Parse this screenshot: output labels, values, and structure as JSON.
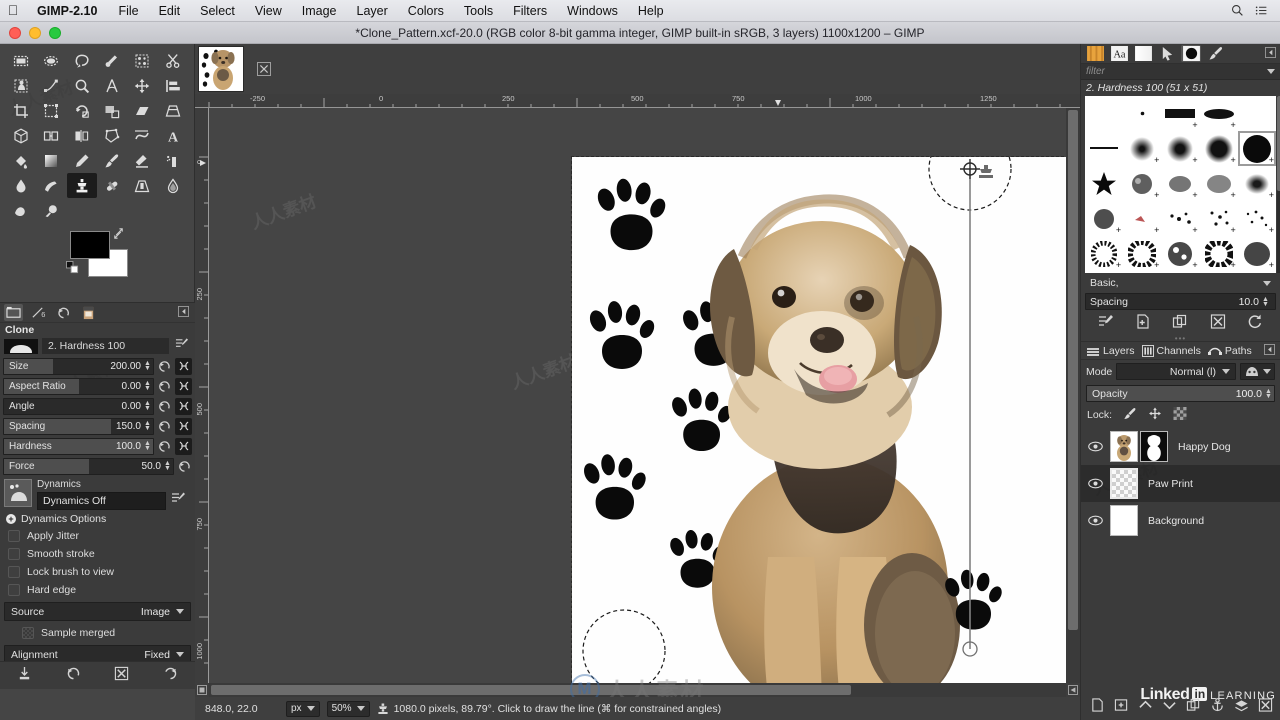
{
  "macmenu": {
    "app": "GIMP-2.10",
    "items": [
      "File",
      "Edit",
      "Select",
      "View",
      "Image",
      "Layer",
      "Colors",
      "Tools",
      "Filters",
      "Windows",
      "Help"
    ],
    "right_icons": [
      "search-icon",
      "list-icon"
    ]
  },
  "window": {
    "title": "*Clone_Pattern.xcf-20.0 (RGB color 8-bit gamma integer, GIMP built-in sRGB, 3 layers) 1100x1200 – GIMP"
  },
  "toolbox": {
    "tools": [
      "rect-select-tool",
      "ellipse-select-tool",
      "free-select-tool",
      "fuzzy-select-tool",
      "select-by-color-tool",
      "scissors-select-tool",
      "foreground-select-tool",
      "paths-tool",
      "color-picker-tool",
      "measure-tool",
      "move-tool",
      "alignment-tool",
      "crop-tool",
      "unified-transform-tool",
      "rotate-tool",
      "scale-tool",
      "shear-tool",
      "perspective-tool",
      "3d-transform-tool",
      "handle-transform-tool",
      "flip-tool",
      "cage-transform-tool",
      "warp-transform-tool",
      "text-tool",
      "bucket-fill-tool",
      "gradient-tool",
      "pencil-tool",
      "paintbrush-tool",
      "eraser-tool",
      "airbrush-tool",
      "ink-tool",
      "mypaint-brush-tool",
      "clone-tool",
      "heal-tool",
      "perspective-clone-tool",
      "blur-sharpen-tool",
      "smudge-tool",
      "dodge-burn-tool"
    ],
    "active_tool_index": 32,
    "foreground_color": "#000000",
    "background_color": "#ffffff"
  },
  "tool_options": {
    "panel_tabs": [
      "tool-options-tab",
      "device-status-tab",
      "undo-history-tab",
      "images-tab"
    ],
    "selected_panel_tab": 0,
    "tool_name": "Clone",
    "brush": "2. Hardness 100",
    "sliders": [
      {
        "label": "Size",
        "value": "200.00",
        "fill": 0.33,
        "link": true
      },
      {
        "label": "Aspect Ratio",
        "value": "0.00",
        "fill": 0.5,
        "link": true
      },
      {
        "label": "Angle",
        "value": "0.00",
        "fill": 0.0,
        "link": true
      },
      {
        "label": "Spacing",
        "value": "150.0",
        "fill": 0.72,
        "link": true
      },
      {
        "label": "Hardness",
        "value": "100.0",
        "fill": 1.0,
        "link": true
      },
      {
        "label": "Force",
        "value": "50.0",
        "fill": 0.5,
        "link": false
      }
    ],
    "dynamics_title": "Dynamics",
    "dynamics_value": "Dynamics Off",
    "dynamics_options_label": "Dynamics Options",
    "checkboxes": [
      {
        "label": "Apply Jitter",
        "checked": false
      },
      {
        "label": "Smooth stroke",
        "checked": false
      },
      {
        "label": "Lock brush to view",
        "checked": false
      },
      {
        "label": "Hard edge",
        "checked": false
      }
    ],
    "source_label": "Source",
    "source_value": "Image",
    "sample_merged_label": "Sample merged",
    "alignment_label": "Alignment",
    "alignment_value": "Fixed",
    "bottom_buttons": [
      "save-tool-preset-icon",
      "restore-tool-preset-icon",
      "delete-tool-preset-icon",
      "reset-tool-options-icon"
    ]
  },
  "image_window": {
    "tab_thumbnail_alt": "image-tab-thumbnail",
    "close_tab": "close-tab-icon",
    "ruler_h_ticks": [
      "-250",
      "0",
      "250",
      "500",
      "750",
      "1000",
      "1250"
    ],
    "ruler_v_ticks": [
      "0",
      "250",
      "500",
      "750",
      "1000"
    ]
  },
  "statusbar": {
    "pointer_position": "848.0, 22.0",
    "unit": "px",
    "zoom": "50%",
    "message": "1080.0 pixels, 89.79°. Click to draw the line (⌘ for constrained angles)"
  },
  "brushes_dock": {
    "tabs": [
      "patterns-tab",
      "fonts-tab",
      "gradients-tab",
      "pointer-tab",
      "brushes-tab",
      "paint-dynamics-tab"
    ],
    "selected_tab": 4,
    "filter_placeholder": "filter",
    "selected_brush_info": "2. Hardness 100 (51 x 51)",
    "tag_label": "Basic,",
    "spacing_label": "Spacing",
    "spacing_value": "10.0",
    "buttons": [
      "edit-brush-icon",
      "new-brush-icon",
      "duplicate-brush-icon",
      "delete-brush-icon",
      "refresh-brushes-icon"
    ],
    "selected_brush_index": 9
  },
  "layers_dock": {
    "tabs": [
      {
        "label": "Layers",
        "icon": "layers-icon",
        "selected": true
      },
      {
        "label": "Channels",
        "icon": "channels-icon",
        "selected": false
      },
      {
        "label": "Paths",
        "icon": "paths-icon",
        "selected": false
      }
    ],
    "mode_label": "Mode",
    "mode_value": "Normal (l)",
    "opacity_label": "Opacity",
    "opacity_value": "100.0",
    "lock_label": "Lock:",
    "lock_icons": [
      "lock-pixels-icon",
      "lock-position-icon",
      "lock-alpha-icon"
    ],
    "layers": [
      {
        "name": "Happy Dog",
        "visible": true,
        "selected": false,
        "kind": "dog",
        "has_mask": true
      },
      {
        "name": "Paw Print",
        "visible": true,
        "selected": true,
        "kind": "transparent",
        "has_mask": false
      },
      {
        "name": "Background",
        "visible": true,
        "selected": false,
        "kind": "white",
        "has_mask": false
      }
    ],
    "buttons": [
      "new-layer-icon",
      "new-layer-group-icon",
      "raise-layer-icon",
      "lower-layer-icon",
      "duplicate-layer-icon",
      "anchor-layer-icon",
      "merge-down-icon",
      "delete-layer-icon"
    ]
  },
  "watermark": {
    "brand_1": "Linked",
    "brand_2": "in",
    "brand_3": "LEARNING",
    "center_logo": "M",
    "center_text": "人人素材"
  }
}
